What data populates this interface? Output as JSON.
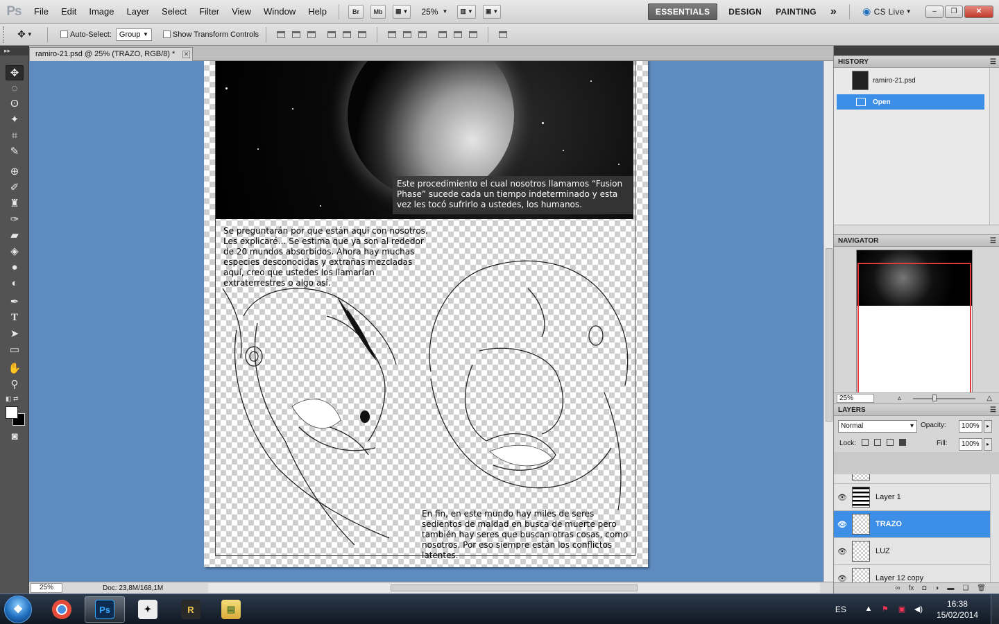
{
  "app": {
    "logo": "Ps",
    "menu": [
      "File",
      "Edit",
      "Image",
      "Layer",
      "Select",
      "Filter",
      "View",
      "Window",
      "Help"
    ],
    "bridge_btn": "Br",
    "minibridge_btn": "Mb",
    "zoom_level": "25%",
    "workspaces": [
      "ESSENTIALS",
      "DESIGN",
      "PAINTING"
    ],
    "active_workspace": "ESSENTIALS",
    "more_workspaces": "»",
    "cs_live": "CS Live",
    "window_controls": {
      "minimize": "–",
      "restore": "❐",
      "close": "✕"
    }
  },
  "options_bar": {
    "tool_icon": "move-tool-icon",
    "auto_select_label": "Auto-Select:",
    "auto_select_checked": false,
    "auto_select_target": "Group",
    "show_transform_label": "Show Transform Controls",
    "show_transform_checked": false
  },
  "document": {
    "tab_title": "ramiro-21.psd @ 25% (TRAZO, RGB/8) *",
    "tab_close": "✕",
    "status_zoom": "25%",
    "status_doc": "Doc: 23,8M/168,1M",
    "caption_top": "Este procedimiento el cual nosotros llamamos “Fusion Phase” sucede cada un tiempo indeterminado y esta vez les tocó sufrirlo a ustedes, los humanos.",
    "caption_middle": "Se preguntarán por que están aqui con nosotros. Les explicaré… Se estima que ya son al rededor de 20 mundos absorbidos. Ahora hay muchas especies desconocidas y extrañas mezcladas aquí, creo que ustedes los llamarían extraterrestres o algo así.",
    "caption_bottom": "En fin, en este mundo hay miles de seres sedientos de maldad en busca de muerte pero también hay seres que buscan otras cosas, como nosotros. Por eso siempre están los conflictos latentes."
  },
  "panels": {
    "history": {
      "title": "HISTORY",
      "snapshot": "ramiro-21.psd",
      "states": [
        "Open"
      ],
      "selected_state": "Open"
    },
    "navigator": {
      "title": "NAVIGATOR",
      "zoom": "25%"
    },
    "layers": {
      "title": "LAYERS",
      "blend_mode": "Normal",
      "opacity_label": "Opacity:",
      "opacity": "100%",
      "lock_label": "Lock:",
      "fill_label": "Fill:",
      "fill": "100%",
      "items": [
        {
          "name": "Layer 1",
          "visible": true,
          "selected": false
        },
        {
          "name": "TRAZO",
          "visible": true,
          "selected": true
        },
        {
          "name": "LUZ",
          "visible": true,
          "selected": false
        },
        {
          "name": "Layer 12 copy",
          "visible": true,
          "selected": false
        }
      ]
    }
  },
  "taskbar": {
    "start_icon": "windows-logo-icon",
    "apps": [
      "chrome-icon",
      "photoshop-icon",
      "sketch-figure-icon",
      "r-app-icon",
      "folder-icon"
    ],
    "photoshop_label": "Ps",
    "active_app": "photoshop-icon",
    "language": "ES",
    "time": "16:38",
    "date": "15/02/2014"
  },
  "colors": {
    "canvas_bg": "#5e8bc0",
    "selection_blue": "#3d8ee6",
    "panel_dark": "#535353"
  }
}
